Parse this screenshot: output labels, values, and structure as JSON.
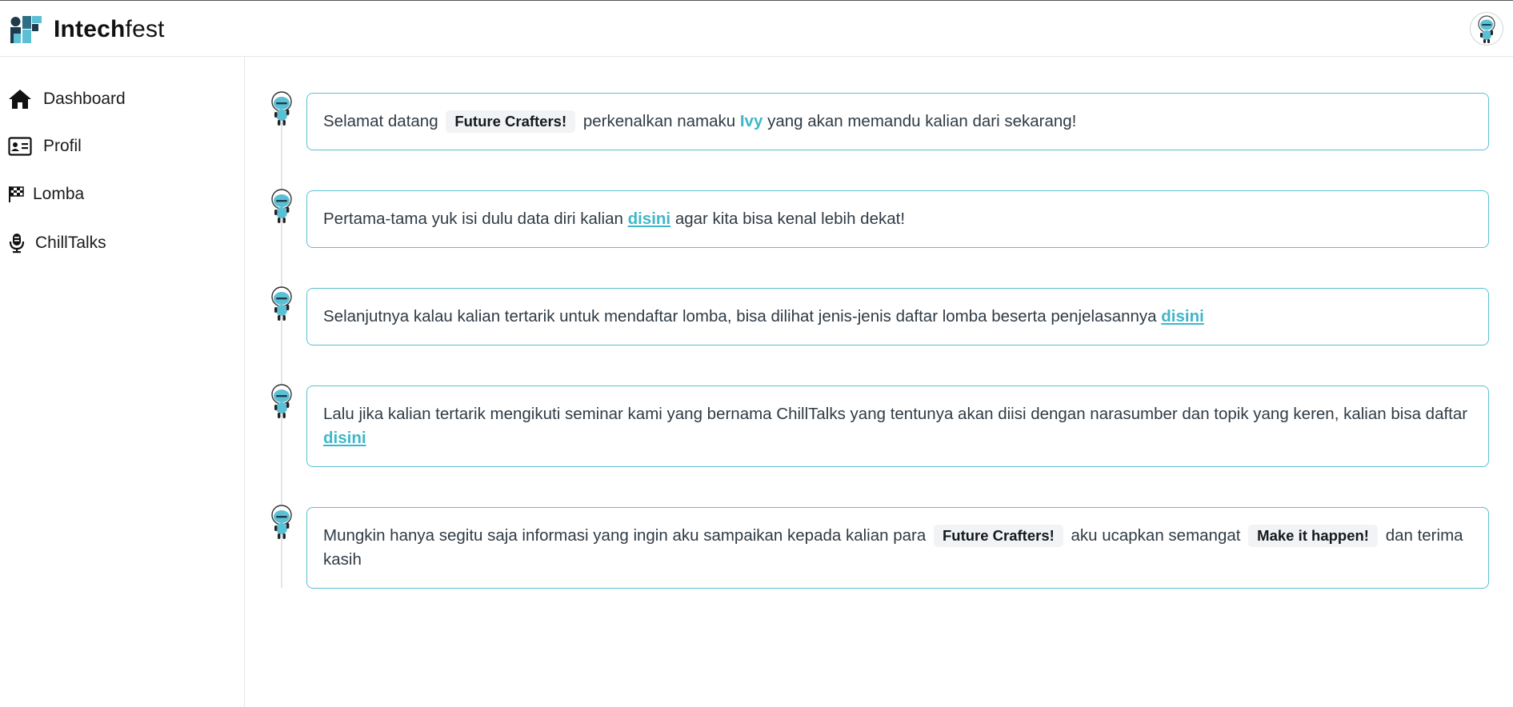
{
  "app": {
    "brand_bold": "Intech",
    "brand_light": "fest",
    "accent_color": "#5bc0d4",
    "profile_icon": "bot-avatar-icon"
  },
  "sidebar": {
    "items": [
      {
        "label": "Dashboard",
        "icon": "home-icon"
      },
      {
        "label": "Profil",
        "icon": "id-card-icon"
      },
      {
        "label": "Lomba",
        "icon": "checkered-flag-icon"
      },
      {
        "label": "ChillTalks",
        "icon": "microphone-icon"
      }
    ]
  },
  "messages": [
    {
      "before": "Selamat datang",
      "tag": "Future Crafters!",
      "middle": "perkenalkan namaku",
      "name": "Ivy",
      "after": "yang akan memandu kalian dari sekarang!"
    },
    {
      "before": "Pertama-tama yuk isi dulu data diri kalian",
      "link": "disini",
      "after": "agar kita bisa kenal lebih dekat!"
    },
    {
      "before": "Selanjutnya kalau kalian tertarik untuk mendaftar lomba, bisa dilihat jenis-jenis daftar lomba beserta penjelasannya",
      "link": "disini"
    },
    {
      "before": "Lalu jika kalian tertarik mengikuti seminar kami yang bernama ChillTalks yang tentunya akan diisi dengan narasumber dan topik yang keren, kalian bisa daftar",
      "link": "disini"
    },
    {
      "before": "Mungkin hanya segitu saja informasi yang ingin aku sampaikan kepada kalian para",
      "tag1": "Future Crafters!",
      "middle": "aku ucapkan semangat",
      "tag2": "Make it happen!",
      "after": "dan terima kasih"
    }
  ]
}
